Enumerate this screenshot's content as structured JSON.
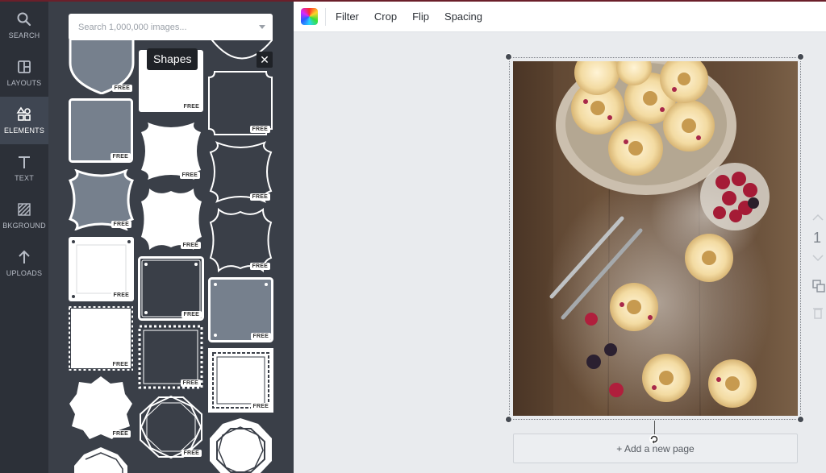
{
  "sidebar": {
    "items": [
      {
        "label": "SEARCH",
        "icon": "search-icon"
      },
      {
        "label": "LAYOUTS",
        "icon": "layouts-icon"
      },
      {
        "label": "ELEMENTS",
        "icon": "elements-icon",
        "active": true
      },
      {
        "label": "TEXT",
        "icon": "text-icon"
      },
      {
        "label": "BKGROUND",
        "icon": "background-icon"
      },
      {
        "label": "UPLOADS",
        "icon": "upload-icon"
      }
    ]
  },
  "panel": {
    "search_placeholder": "Search 1,000,000 images...",
    "tooltip": "Shapes",
    "close_label": "✕",
    "badge": "FREE"
  },
  "toolbar": {
    "filter": "Filter",
    "crop": "Crop",
    "flip": "Flip",
    "spacing": "Spacing"
  },
  "canvas": {
    "add_page_label": "+ Add a new page",
    "page_number": "1"
  },
  "colors": {
    "rail_bg": "#2c3038",
    "panel_bg": "#3a3f48",
    "shape_fill": "#76808d",
    "accent_line": "#6b1f2a"
  }
}
